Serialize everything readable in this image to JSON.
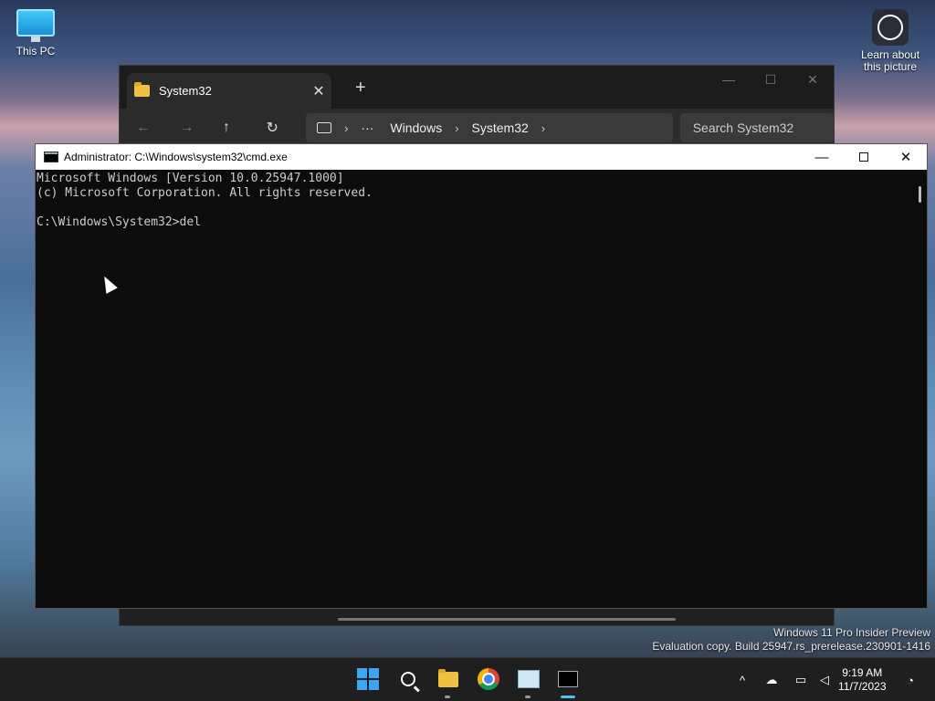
{
  "desktop": {
    "icons": [
      {
        "label": "This PC"
      },
      {
        "label": "Learn about\nthis picture"
      }
    ]
  },
  "explorer": {
    "tab_title": "System32",
    "tab_close": "✕",
    "tab_add": "+",
    "window_controls": [
      "—",
      "☐",
      "✕"
    ],
    "nav": {
      "back": "←",
      "forward": "→",
      "up": "↑",
      "refresh": "↻"
    },
    "breadcrumb": [
      "Windows",
      "System32"
    ],
    "breadcrumb_more": "···",
    "search_placeholder": "Search System32"
  },
  "cmd": {
    "title": "Administrator: C:\\Windows\\system32\\cmd.exe",
    "lines": [
      "Microsoft Windows [Version 10.0.25947.1000]",
      "(c) Microsoft Corporation. All rights reserved.",
      "",
      "C:\\Windows\\System32>del"
    ],
    "controls": {
      "minimize": "—",
      "close": "✕"
    }
  },
  "watermark": {
    "line1": "Windows 11 Pro Insider Preview",
    "line2": "Evaluation copy. Build 25947.rs_prerelease.230901-1416"
  },
  "taskbar": {
    "apps": [
      "start-icon",
      "search-icon",
      "file-explorer-icon",
      "chrome-icon",
      "performance-monitor-icon",
      "terminal-icon"
    ],
    "tray": {
      "chevron": "^"
    },
    "clock": {
      "time": "9:19 AM",
      "date": "11/7/2023"
    }
  },
  "colors": {
    "accent": "#4cc2ff",
    "console_bg": "#0c0c0c",
    "console_text": "#cccccc"
  }
}
